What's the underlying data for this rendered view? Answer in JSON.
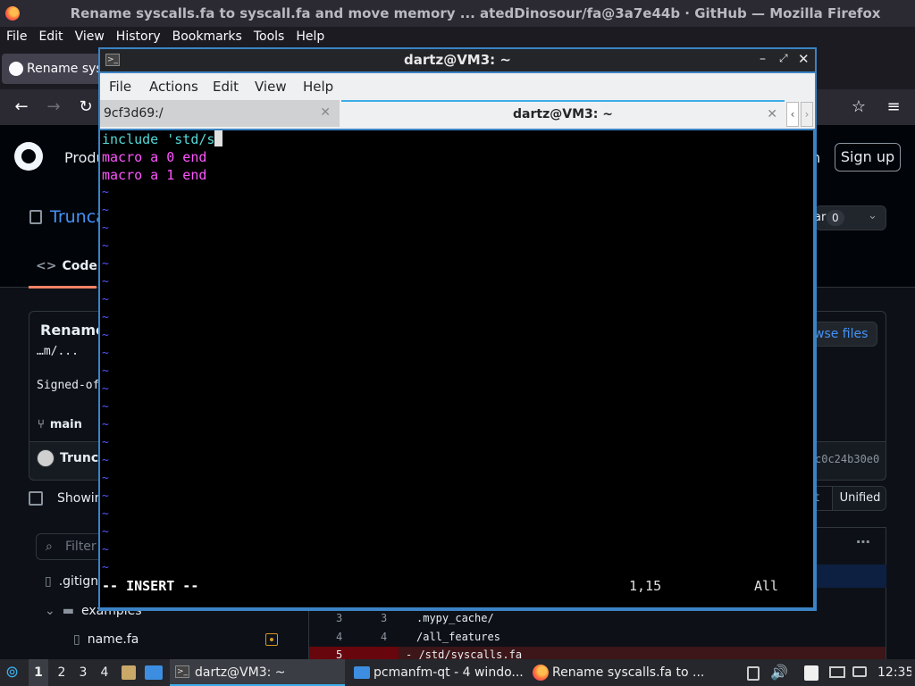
{
  "firefox": {
    "window_title": "Rename syscalls.fa to syscall.fa and move memory ... atedDinosour/fa@3a7e44b · GitHub — Mozilla Firefox",
    "menu": [
      "File",
      "Edit",
      "View",
      "History",
      "Bookmarks",
      "Tools",
      "Help"
    ],
    "tab_label": "Rename sys"
  },
  "github": {
    "nav_product": "Produ",
    "nav_signin": "n",
    "signup": "Sign up",
    "repo_name": "Trunca",
    "star_label": "ar",
    "star_count": "0",
    "code_tab": "Code",
    "commit_title": "Rename",
    "commit_body": "…m/...",
    "signed_off": "Signed-of",
    "branch": "main",
    "author": "Trunca",
    "browse_files": "wse files",
    "commit_hash": "c0c24b30e0",
    "showing": "Showin",
    "split_label": "t",
    "unified": "Unified",
    "filter_placeholder": "Filter",
    "tree": [
      ".gitign",
      "examples",
      "name.fa"
    ],
    "diff_lines": [
      {
        "old": "3",
        "new": "3",
        "text": ".mypy_cache/"
      },
      {
        "old": "4",
        "new": "4",
        "text": "/all_features"
      },
      {
        "old": "5",
        "new": "",
        "text": "- /std/syscalls.fa"
      }
    ]
  },
  "terminal": {
    "title": "dartz@VM3: ~",
    "menu": [
      "File",
      "Actions",
      "Edit",
      "View",
      "Help"
    ],
    "tab1": "9cf3d69:/",
    "tab2": "dartz@VM3: ~",
    "lines": [
      "include 'std/s",
      "macro a 0 end",
      "macro a 1 end"
    ],
    "tilde_count": 22,
    "mode": "-- INSERT --",
    "position": "1,15",
    "scroll": "All",
    "colors": {
      "include": "#55d7d7",
      "macro": "#ff55ff",
      "tilde": "#5555ff"
    }
  },
  "taskbar": {
    "workspaces": [
      "1",
      "2",
      "3",
      "4"
    ],
    "tasks": [
      "dartz@VM3: ~",
      "pcmanfm-qt - 4 windo...",
      "Rename syscalls.fa to ..."
    ],
    "clock": "12:35"
  }
}
